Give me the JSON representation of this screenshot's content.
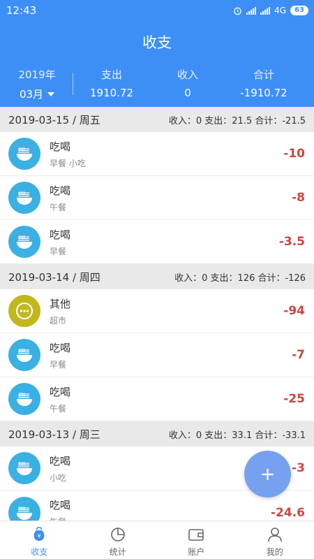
{
  "status_bar": {
    "time": "12:43",
    "network": "4G",
    "battery": "63"
  },
  "header": {
    "title": "收支",
    "year": "2019年",
    "month": "03月",
    "expense_label": "支出",
    "expense_value": "1910.72",
    "income_label": "收入",
    "income_value": "0",
    "total_label": "合计",
    "total_value": "-1910.72"
  },
  "days": [
    {
      "date": "2019-03-15 / 周五",
      "summary": "收入：0  支出：21.5  合计：-21.5",
      "entries": [
        {
          "category": "吃喝",
          "note": "早餐 小吃",
          "amount": "-10",
          "icon": "noodle-bowl-icon"
        },
        {
          "category": "吃喝",
          "note": "午餐",
          "amount": "-8",
          "icon": "noodle-bowl-icon"
        },
        {
          "category": "吃喝",
          "note": "早餐",
          "amount": "-3.5",
          "icon": "noodle-bowl-icon"
        }
      ]
    },
    {
      "date": "2019-03-14 / 周四",
      "summary": "收入：0  支出：126  合计：-126",
      "entries": [
        {
          "category": "其他",
          "note": "超市",
          "amount": "-94",
          "icon": "more-dots-icon"
        },
        {
          "category": "吃喝",
          "note": "早餐",
          "amount": "-7",
          "icon": "noodle-bowl-icon"
        },
        {
          "category": "吃喝",
          "note": "午餐",
          "amount": "-25",
          "icon": "noodle-bowl-icon"
        }
      ]
    },
    {
      "date": "2019-03-13 / 周三",
      "summary": "收入：0  支出：33.1  合计：-33.1",
      "entries": [
        {
          "category": "吃喝",
          "note": "小吃",
          "amount": "-3",
          "icon": "noodle-bowl-icon"
        },
        {
          "category": "吃喝",
          "note": "午餐",
          "amount": "-24.6",
          "icon": "noodle-bowl-icon"
        }
      ]
    }
  ],
  "fab": {
    "label": "+"
  },
  "bottom_nav": [
    {
      "label": "收支",
      "icon": "money-bag-icon",
      "active": true
    },
    {
      "label": "统计",
      "icon": "pie-chart-icon",
      "active": false
    },
    {
      "label": "账户",
      "icon": "wallet-icon",
      "active": false
    },
    {
      "label": "我的",
      "icon": "person-icon",
      "active": false
    }
  ],
  "colors": {
    "primary": "#3d8ff5",
    "expense_red": "#cc4545",
    "food_icon_bg": "#3bb0e3",
    "other_icon_bg": "#c3b71f"
  }
}
